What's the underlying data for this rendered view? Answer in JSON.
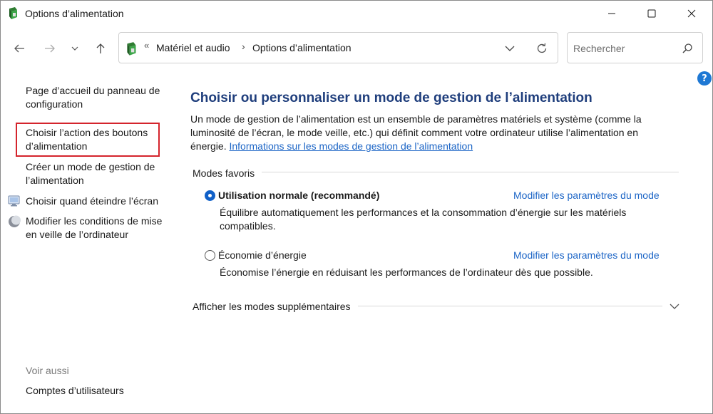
{
  "window": {
    "title": "Options d’alimentation"
  },
  "address": {
    "chevrons": "«",
    "crumbs": [
      "Matériel et audio",
      "Options d’alimentation"
    ],
    "separator": "›"
  },
  "search": {
    "placeholder": "Rechercher"
  },
  "sidebar": {
    "links": [
      {
        "label": "Page d’accueil du panneau de configuration",
        "icon": null
      },
      {
        "label": "Choisir l’action des boutons d’alimentation",
        "icon": null,
        "highlighted": true
      },
      {
        "label": "Créer un mode de gestion de l’alimentation",
        "icon": null
      },
      {
        "label": "Choisir quand éteindre l’écran",
        "icon": "monitor-icon"
      },
      {
        "label": "Modifier les conditions de mise en veille de l’ordinateur",
        "icon": "moon-icon"
      }
    ],
    "see_also_heading": "Voir aussi",
    "see_also_links": [
      "Comptes d’utilisateurs"
    ]
  },
  "main": {
    "title": "Choisir ou personnaliser un mode de gestion de l’alimentation",
    "description": "Un mode de gestion de l’alimentation est un ensemble de paramètres matériels et système (comme la luminosité de l’écran, le mode veille, etc.) qui définit comment votre ordinateur utilise l’alimentation en énergie.",
    "description_link": "Informations sur les modes de gestion de l’alimentation",
    "favorites_heading": "Modes favoris",
    "plans": [
      {
        "name": "Utilisation normale (recommandé)",
        "selected": true,
        "change_link": "Modifier les paramètres du mode",
        "description": "Équilibre automatiquement les performances et la consommation d’énergie sur les matériels compatibles."
      },
      {
        "name": "Économie d’énergie",
        "selected": false,
        "change_link": "Modifier les paramètres du mode",
        "description": "Économise l’énergie en réduisant les performances de l’ordinateur dès que possible."
      }
    ],
    "show_more_label": "Afficher les modes supplémentaires"
  },
  "colors": {
    "accent": "#1c65c6",
    "title": "#1f3e7c",
    "highlight_border": "#d4242c"
  }
}
